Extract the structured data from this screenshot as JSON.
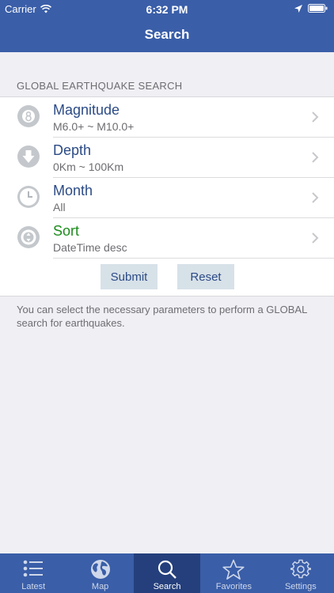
{
  "status": {
    "carrier": "Carrier",
    "time": "6:32 PM"
  },
  "nav": {
    "title": "Search"
  },
  "section": {
    "header": "GLOBAL EARTHQUAKE SEARCH"
  },
  "rows": [
    {
      "title": "Magnitude",
      "value": "M6.0+ ~ M10.0+",
      "icon": "magnitude-8-icon"
    },
    {
      "title": "Depth",
      "value": "0Km ~ 100Km",
      "icon": "depth-arrow-down-icon"
    },
    {
      "title": "Month",
      "value": "All",
      "icon": "clock-icon"
    },
    {
      "title": "Sort",
      "value": "DateTime desc",
      "icon": "sort-icon"
    }
  ],
  "buttons": {
    "submit": "Submit",
    "reset": "Reset"
  },
  "note": "You can select the necessary parameters to perform a GLOBAL search for earthquakes.",
  "tabs": [
    {
      "label": "Latest",
      "icon": "list-icon"
    },
    {
      "label": "Map",
      "icon": "globe-icon"
    },
    {
      "label": "Search",
      "icon": "search-icon",
      "active": true
    },
    {
      "label": "Favorites",
      "icon": "star-icon"
    },
    {
      "label": "Settings",
      "icon": "gear-icon"
    }
  ],
  "colors": {
    "nav": "#3a5ea8",
    "tab_active": "#243f7c",
    "accent": "#2c4b86",
    "sort_title": "#1c8c1c",
    "button_bg": "#d7e1e8"
  }
}
